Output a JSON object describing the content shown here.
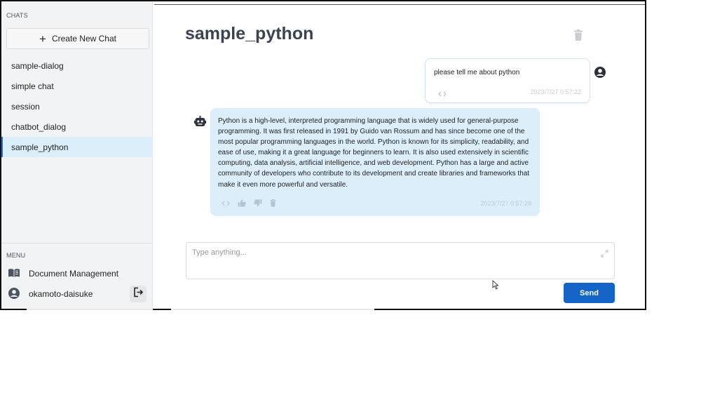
{
  "sidebar": {
    "chats_label": "CHATS",
    "new_chat_label": "Create New Chat",
    "chats": [
      {
        "label": "sample-dialog"
      },
      {
        "label": "simple chat"
      },
      {
        "label": "session"
      },
      {
        "label": "chatbot_dialog"
      },
      {
        "label": "sample_python",
        "active": true
      }
    ],
    "menu_label": "MENU",
    "menu_items": [
      {
        "label": "Document Management",
        "icon": "book-icon"
      },
      {
        "label": "okamoto-daisuke",
        "icon": "user-circle-icon"
      }
    ]
  },
  "main": {
    "title": "sample_python",
    "messages": [
      {
        "role": "user",
        "text": "please tell me about python",
        "timestamp": "2023/7/27 0:57:22"
      },
      {
        "role": "assistant",
        "text": "Python is a high-level, interpreted programming language that is widely used for general-purpose programming. It was first released in 1991 by Guido van Rossum and has since become one of the most popular programming languages in the world. Python is known for its simplicity, readability, and ease of use, making it a great language for beginners to learn. It is also used extensively in scientific computing, data analysis, artificial intelligence, and web development. Python has a large and active community of developers who contribute to its development and create libraries and frameworks that make it even more powerful and versatile.",
        "timestamp": "2023/7/27 0:57:29"
      }
    ],
    "input_placeholder": "Type anything...",
    "send_label": "Send"
  },
  "colors": {
    "accent": "#1565c8",
    "active_item_bg": "#ddeefb",
    "bot_bubble_bg": "#ddeefb",
    "title": "#3c4350"
  }
}
